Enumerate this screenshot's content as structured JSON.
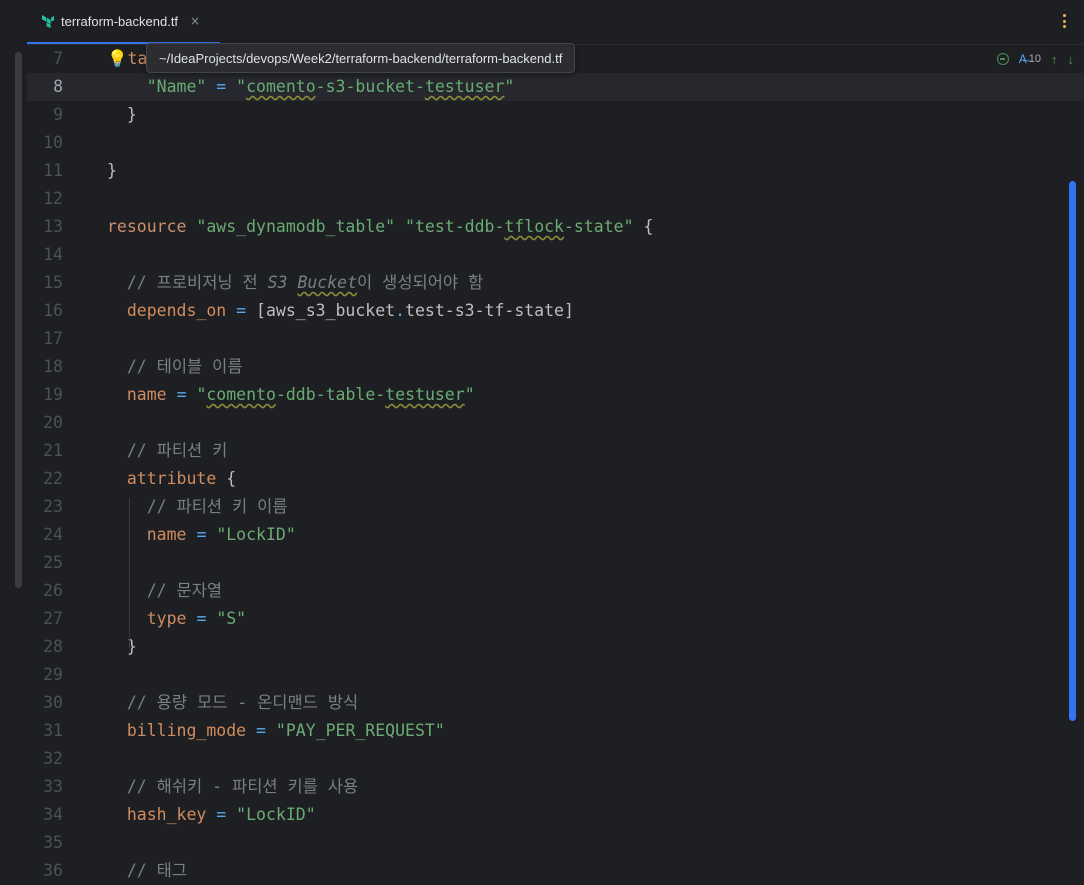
{
  "tab": {
    "label": "terraform-backend.tf",
    "close": "×"
  },
  "tooltip": {
    "path": "~/IdeaProjects/devops/Week2/terraform-backend/terraform-backend.tf"
  },
  "inspection": {
    "typo_count": "10"
  },
  "colors": {
    "accent": "#3574f0",
    "terraform_logo": "#22c3a3",
    "bulb": "#e9b74a"
  },
  "icons": [
    "terraform-icon",
    "close-icon",
    "more-options-icon",
    "lightbulb-icon",
    "no-problems-icon",
    "typo-icon",
    "arrow-up-icon",
    "arrow-down-icon"
  ],
  "lines": [
    {
      "n": "7",
      "tokens": [
        [
          "bulb",
          "💡"
        ],
        [
          "attr",
          "ta"
        ]
      ]
    },
    {
      "n": "8",
      "tokens": [
        [
          "plain",
          "    "
        ],
        [
          "str",
          "\"Name\""
        ],
        [
          "plain",
          " "
        ],
        [
          "eq",
          "="
        ],
        [
          "plain",
          " "
        ],
        [
          "str",
          "\""
        ],
        [
          "strtypo",
          "comento"
        ],
        [
          "str",
          "-s3-bucket-"
        ],
        [
          "strtypo",
          "testuser"
        ],
        [
          "str",
          "\""
        ]
      ]
    },
    {
      "n": "9",
      "tokens": [
        [
          "plain",
          "  }"
        ]
      ]
    },
    {
      "n": "10",
      "tokens": []
    },
    {
      "n": "11",
      "tokens": [
        [
          "plain",
          "}"
        ]
      ]
    },
    {
      "n": "12",
      "tokens": []
    },
    {
      "n": "13",
      "tokens": [
        [
          "kw",
          "resource"
        ],
        [
          "plain",
          " "
        ],
        [
          "str",
          "\"aws_dynamodb_table\""
        ],
        [
          "plain",
          " "
        ],
        [
          "str",
          "\"test-ddb-"
        ],
        [
          "strtypo",
          "tflock"
        ],
        [
          "str",
          "-state\""
        ],
        [
          "plain",
          " {"
        ]
      ]
    },
    {
      "n": "14",
      "tokens": []
    },
    {
      "n": "15",
      "tokens": [
        [
          "plain",
          "  "
        ],
        [
          "cmt",
          "// 프로비저닝 전 "
        ],
        [
          "cmtit",
          "S3 "
        ],
        [
          "cmtittypo",
          "Bucket"
        ],
        [
          "cmt",
          "이 생성되어야 함"
        ]
      ]
    },
    {
      "n": "16",
      "tokens": [
        [
          "plain",
          "  "
        ],
        [
          "attr",
          "depends_on"
        ],
        [
          "plain",
          " "
        ],
        [
          "eq",
          "="
        ],
        [
          "plain",
          " [aws_s3_bucket"
        ],
        [
          "dot",
          "."
        ],
        [
          "plain",
          "test-s3-tf-state]"
        ]
      ]
    },
    {
      "n": "17",
      "tokens": []
    },
    {
      "n": "18",
      "tokens": [
        [
          "plain",
          "  "
        ],
        [
          "cmt",
          "// 테이블 이름"
        ]
      ]
    },
    {
      "n": "19",
      "tokens": [
        [
          "plain",
          "  "
        ],
        [
          "attr",
          "name"
        ],
        [
          "plain",
          " "
        ],
        [
          "eq",
          "="
        ],
        [
          "plain",
          " "
        ],
        [
          "str",
          "\""
        ],
        [
          "strtypo",
          "comento"
        ],
        [
          "str",
          "-ddb-table-"
        ],
        [
          "strtypo",
          "testuser"
        ],
        [
          "str",
          "\""
        ]
      ]
    },
    {
      "n": "20",
      "tokens": []
    },
    {
      "n": "21",
      "tokens": [
        [
          "plain",
          "  "
        ],
        [
          "cmt",
          "// 파티션 키"
        ]
      ]
    },
    {
      "n": "22",
      "tokens": [
        [
          "plain",
          "  "
        ],
        [
          "attr",
          "attribute"
        ],
        [
          "plain",
          " {"
        ]
      ]
    },
    {
      "n": "23",
      "tokens": [
        [
          "plain",
          "    "
        ],
        [
          "cmt",
          "// 파티션 키 이름"
        ]
      ]
    },
    {
      "n": "24",
      "tokens": [
        [
          "plain",
          "    "
        ],
        [
          "attr",
          "name"
        ],
        [
          "plain",
          " "
        ],
        [
          "eq",
          "="
        ],
        [
          "plain",
          " "
        ],
        [
          "str",
          "\"LockID\""
        ]
      ]
    },
    {
      "n": "25",
      "tokens": []
    },
    {
      "n": "26",
      "tokens": [
        [
          "plain",
          "    "
        ],
        [
          "cmt",
          "// 문자열"
        ]
      ]
    },
    {
      "n": "27",
      "tokens": [
        [
          "plain",
          "    "
        ],
        [
          "attr",
          "type"
        ],
        [
          "plain",
          " "
        ],
        [
          "eq",
          "="
        ],
        [
          "plain",
          " "
        ],
        [
          "str",
          "\"S\""
        ]
      ]
    },
    {
      "n": "28",
      "tokens": [
        [
          "plain",
          "  }"
        ]
      ]
    },
    {
      "n": "29",
      "tokens": []
    },
    {
      "n": "30",
      "tokens": [
        [
          "plain",
          "  "
        ],
        [
          "cmt",
          "// 용량 모드 - 온디맨드 방식"
        ]
      ]
    },
    {
      "n": "31",
      "tokens": [
        [
          "plain",
          "  "
        ],
        [
          "attr",
          "billing_mode"
        ],
        [
          "plain",
          " "
        ],
        [
          "eq",
          "="
        ],
        [
          "plain",
          " "
        ],
        [
          "str",
          "\"PAY_PER_REQUEST\""
        ]
      ]
    },
    {
      "n": "32",
      "tokens": []
    },
    {
      "n": "33",
      "tokens": [
        [
          "plain",
          "  "
        ],
        [
          "cmt",
          "// 해쉬키 - 파티션 키를 사용"
        ]
      ]
    },
    {
      "n": "34",
      "tokens": [
        [
          "plain",
          "  "
        ],
        [
          "attr",
          "hash_key"
        ],
        [
          "plain",
          " "
        ],
        [
          "eq",
          "="
        ],
        [
          "plain",
          " "
        ],
        [
          "str",
          "\"LockID\""
        ]
      ]
    },
    {
      "n": "35",
      "tokens": []
    },
    {
      "n": "36",
      "tokens": [
        [
          "plain",
          "  "
        ],
        [
          "cmt",
          "// 태그"
        ]
      ]
    }
  ]
}
